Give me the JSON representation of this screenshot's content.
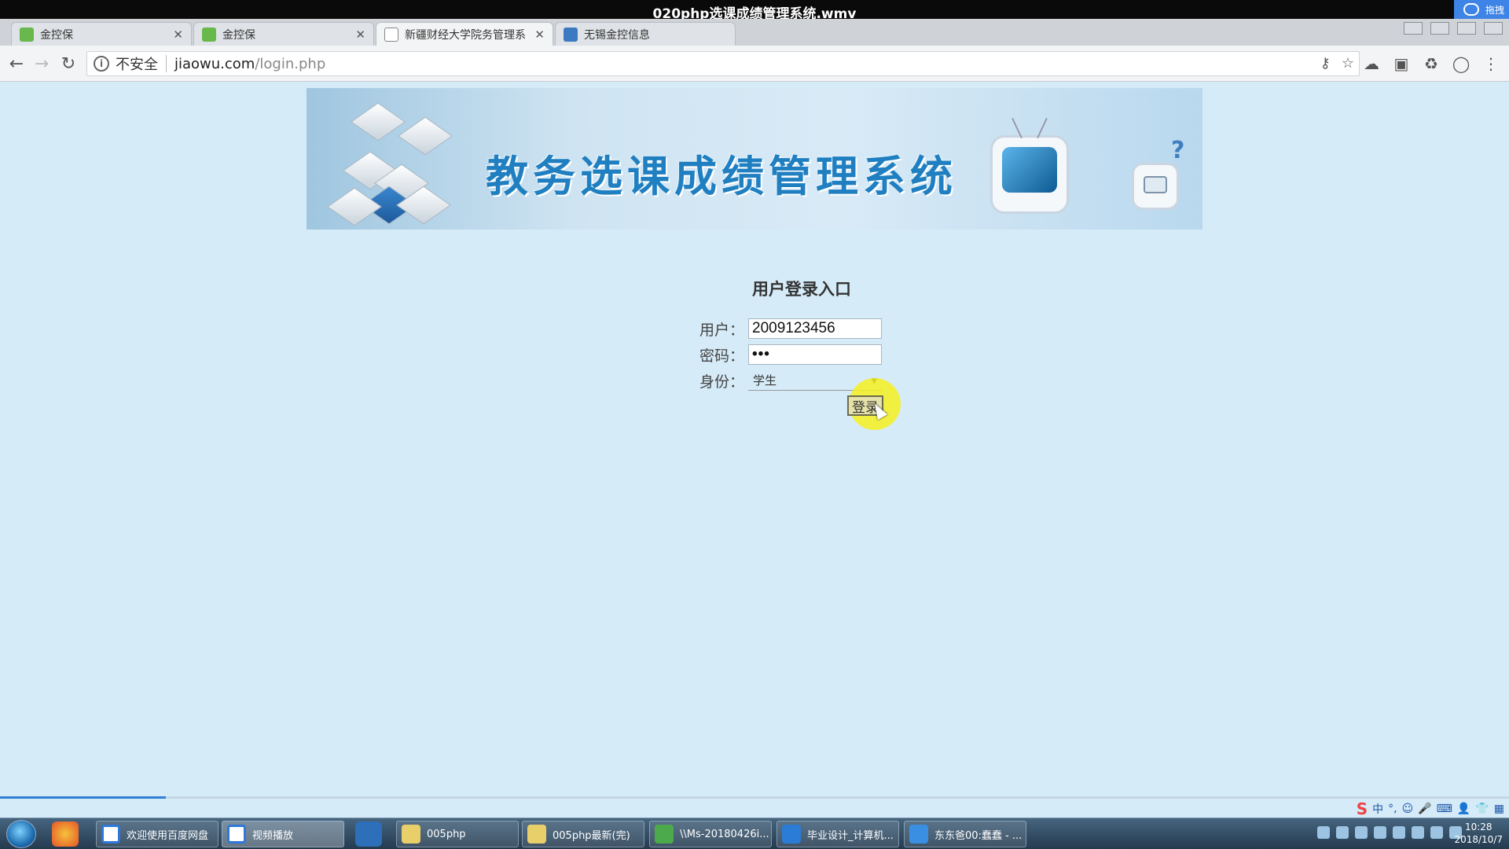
{
  "video": {
    "title": "020php选课成绩管理系统.wmv",
    "progress_percent": 11,
    "cloud_label": "拖拽"
  },
  "browser": {
    "tabs": [
      {
        "title": "金控保",
        "favicon": "green-shield-icon",
        "active": false
      },
      {
        "title": "金控保",
        "favicon": "green-shield-icon",
        "active": false
      },
      {
        "title": "新疆财经大学院务管理系",
        "favicon": "document-icon",
        "active": true
      },
      {
        "title": "无锡金控信息",
        "favicon": "blue-page-icon",
        "active": false
      }
    ],
    "security_label": "不安全",
    "url_host": "jiaowu.com",
    "url_path": "/login.php"
  },
  "banner": {
    "title": "教务选课成绩管理系统",
    "qmark": "?"
  },
  "login": {
    "heading": "用户登录入口",
    "user_label": "用户：",
    "user_value": "2009123456",
    "password_label": "密码：",
    "password_value": "•••",
    "role_label": "身份：",
    "role_value": "学生",
    "submit_label": "登录"
  },
  "ime": {
    "items": [
      "S",
      "中",
      "°,",
      "☺",
      "🎤",
      "⌨",
      "👤",
      "👕",
      "▦"
    ]
  },
  "taskbar": {
    "tasks": [
      {
        "label": "欢迎使用百度网盘",
        "icon": "baidu-cloud-icon"
      },
      {
        "label": "视频播放",
        "icon": "baidu-cloud-icon"
      },
      {
        "label": "005php",
        "icon": "folder-icon"
      },
      {
        "label": "005php最新(完)",
        "icon": "folder-icon"
      },
      {
        "label": "\\\\Ms-20180426i...",
        "icon": "notepad-icon"
      },
      {
        "label": "毕业设计_计算机...",
        "icon": "sogou-icon"
      },
      {
        "label": "东东爸00:蠢蠢 - ...",
        "icon": "chat-icon"
      }
    ],
    "time": "10:28",
    "date": "2018/10/7"
  }
}
